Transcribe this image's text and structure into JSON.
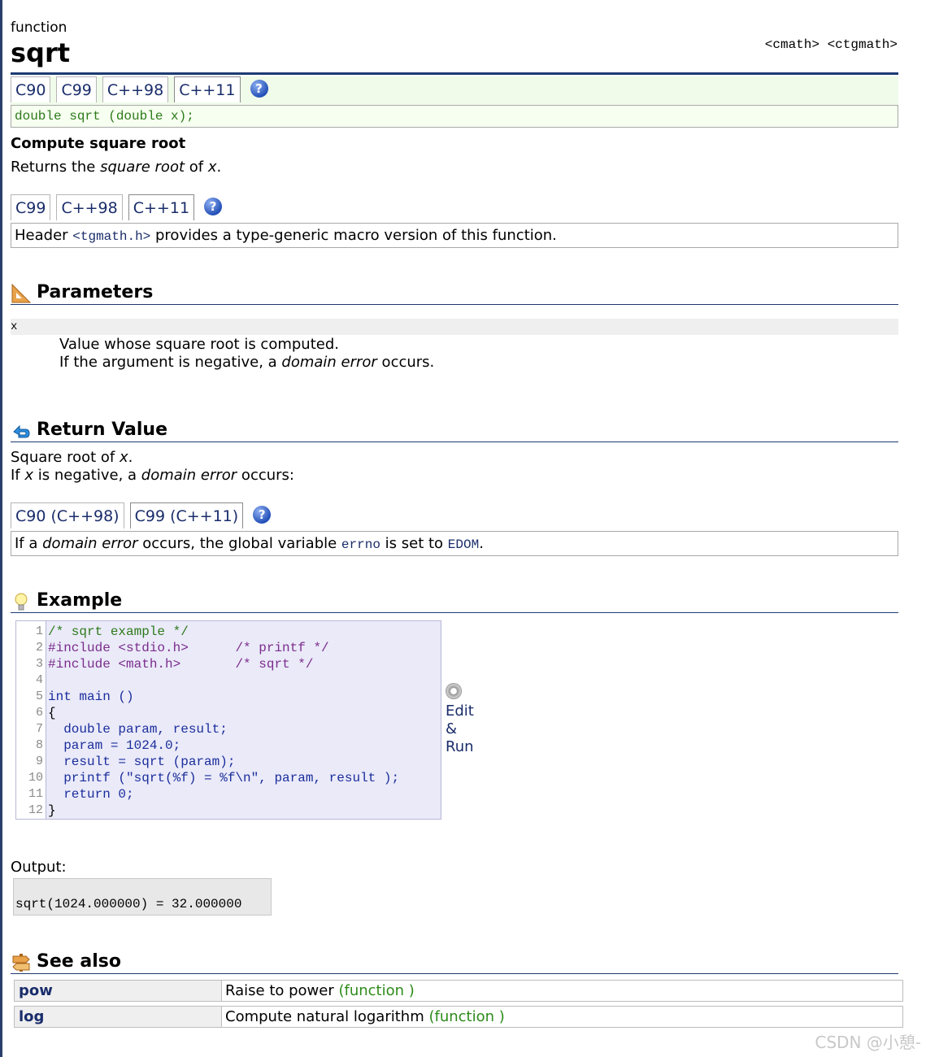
{
  "page": {
    "kind": "function",
    "title": "sqrt",
    "headers": "<cmath> <ctgmath>"
  },
  "proto_tabs": [
    "C90",
    "C99",
    "C++98",
    "C++11"
  ],
  "prototype": "double sqrt (double x);",
  "summary": {
    "heading": "Compute square root",
    "pre": "Returns the ",
    "em": "square root",
    "mid": " of ",
    "var": "x",
    "post": "."
  },
  "header_tabs": [
    "C99",
    "C++98",
    "C++11"
  ],
  "header_note": {
    "pre": "Header ",
    "code": "<tgmath.h>",
    "post": " provides a type-generic macro version of this function."
  },
  "parameters": {
    "heading": "Parameters",
    "name": "x",
    "line1": "Value whose square root is computed.",
    "line2_pre": "If the argument is negative, a ",
    "line2_em": "domain error",
    "line2_post": " occurs."
  },
  "return_value": {
    "heading": "Return Value",
    "l1_pre": "Square root of ",
    "l1_var": "x",
    "l1_post": ".",
    "l2_pre": "If ",
    "l2_var": "x",
    "l2_mid": " is negative, a ",
    "l2_em": "domain error",
    "l2_post": " occurs:"
  },
  "error_tabs": [
    "C90 (C++98)",
    "C99 (C++11)"
  ],
  "error_note": {
    "pre": "If a ",
    "em": "domain error",
    "mid": " occurs, the global variable ",
    "code1": "errno",
    "mid2": " is set to ",
    "code2": "EDOM",
    "post": "."
  },
  "example": {
    "heading": "Example",
    "line_numbers": [
      "1",
      "2",
      "3",
      "4",
      "5",
      "6",
      "7",
      "8",
      "9",
      "10",
      "11",
      "12"
    ],
    "code": [
      "/* sqrt example */",
      "#include <stdio.h>      /* printf */",
      "#include <math.h>       /* sqrt */",
      "",
      "int main ()",
      "{",
      "  double param, result;",
      "  param = 1024.0;",
      "  result = sqrt (param);",
      "  printf (\"sqrt(%f) = %f\\n\", param, result );",
      "  return 0;",
      "}"
    ],
    "edit_label": "Edit",
    "amp_label": "&",
    "run_label": "Run",
    "output_label": "Output:",
    "output": "sqrt(1024.000000) = 32.000000"
  },
  "see_also": {
    "heading": "See also",
    "items": [
      {
        "name": "pow",
        "desc": "Raise to power ",
        "kind": "(function )"
      },
      {
        "name": "log",
        "desc": "Compute natural logarithm ",
        "kind": "(function )"
      }
    ]
  },
  "watermark": "CSDN @小憩-",
  "question_mark": "?"
}
